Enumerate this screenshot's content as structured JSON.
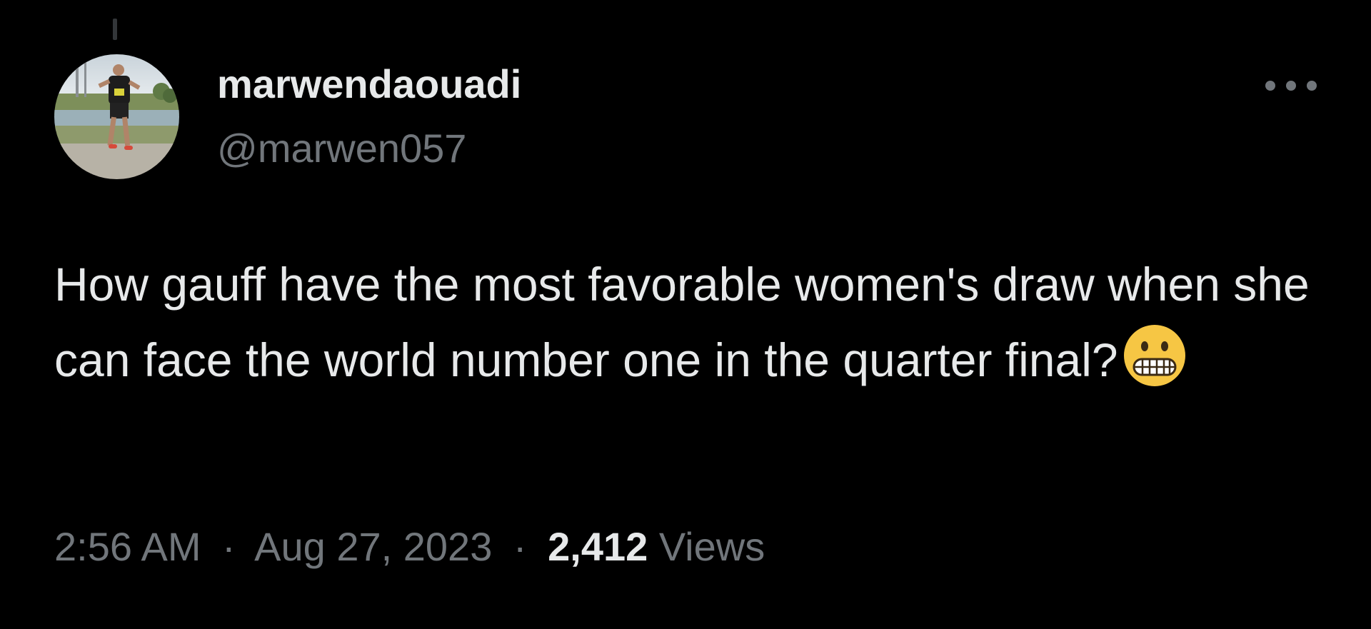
{
  "tweet": {
    "author": {
      "display_name": "marwendaouadi",
      "handle": "@marwen057",
      "avatar_icon": "runner-photo-avatar"
    },
    "more_icon": "ellipsis-icon",
    "text": "How gauff have the most favorable women's draw when she can face the world number one in the quarter final?",
    "emoji": "grimacing-face",
    "time": "2:56 AM",
    "separator": "·",
    "date": "Aug 27, 2023",
    "views_count": "2,412",
    "views_label": "Views"
  },
  "colors": {
    "background": "#000000",
    "primary_text": "#e7e9ea",
    "secondary_text": "#71767b",
    "emoji_yellow": "#f6c644"
  }
}
